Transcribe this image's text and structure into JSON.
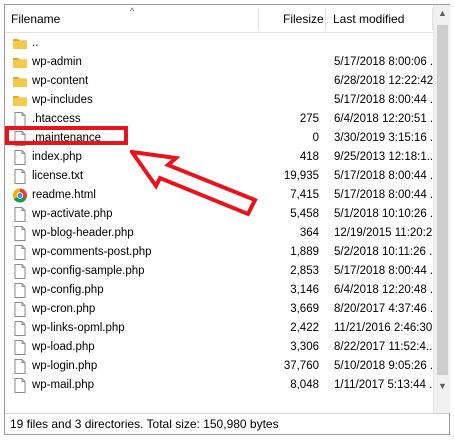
{
  "header": {
    "filename": "Filename",
    "filesize": "Filesize",
    "last_modified": "Last modified",
    "sort_indicator": "^"
  },
  "files": [
    {
      "name": "..",
      "size": "",
      "modified": "",
      "icon": "folder-icon"
    },
    {
      "name": "wp-admin",
      "size": "",
      "modified": "5/17/2018 8:00:06 ...",
      "icon": "folder-icon"
    },
    {
      "name": "wp-content",
      "size": "",
      "modified": "6/28/2018 12:22:42...",
      "icon": "folder-icon"
    },
    {
      "name": "wp-includes",
      "size": "",
      "modified": "5/17/2018 8:00:44 ...",
      "icon": "folder-icon"
    },
    {
      "name": ".htaccess",
      "size": "275",
      "modified": "6/4/2018 12:20:51 ...",
      "icon": "file-icon"
    },
    {
      "name": ".maintenance",
      "size": "0",
      "modified": "3/30/2019 3:15:16 ...",
      "icon": "file-icon"
    },
    {
      "name": "index.php",
      "size": "418",
      "modified": "9/25/2013 12:18:1...",
      "icon": "file-icon"
    },
    {
      "name": "license.txt",
      "size": "19,935",
      "modified": "5/17/2018 8:00:44 ...",
      "icon": "file-icon"
    },
    {
      "name": "readme.html",
      "size": "7,415",
      "modified": "5/17/2018 8:00:44 ...",
      "icon": "chrome-icon"
    },
    {
      "name": "wp-activate.php",
      "size": "5,458",
      "modified": "5/1/2018 10:10:26 ...",
      "icon": "file-icon"
    },
    {
      "name": "wp-blog-header.php",
      "size": "364",
      "modified": "12/19/2015 11:20:2...",
      "icon": "file-icon"
    },
    {
      "name": "wp-comments-post.php",
      "size": "1,889",
      "modified": "5/2/2018 10:11:26 ...",
      "icon": "file-icon"
    },
    {
      "name": "wp-config-sample.php",
      "size": "2,853",
      "modified": "5/17/2018 8:00:44 ...",
      "icon": "file-icon"
    },
    {
      "name": "wp-config.php",
      "size": "3,146",
      "modified": "6/4/2018 12:20:48 ...",
      "icon": "file-icon"
    },
    {
      "name": "wp-cron.php",
      "size": "3,669",
      "modified": "8/20/2017 4:37:46 ...",
      "icon": "file-icon"
    },
    {
      "name": "wp-links-opml.php",
      "size": "2,422",
      "modified": "11/21/2016 2:46:30...",
      "icon": "file-icon"
    },
    {
      "name": "wp-load.php",
      "size": "3,306",
      "modified": "8/22/2017 11:52:4...",
      "icon": "file-icon"
    },
    {
      "name": "wp-login.php",
      "size": "37,760",
      "modified": "5/10/2018 9:05:26 ...",
      "icon": "file-icon"
    },
    {
      "name": "wp-mail.php",
      "size": "8,048",
      "modified": "1/11/2017 5:13:44 ...",
      "icon": "file-icon"
    }
  ],
  "status": "19 files and 3 directories. Total size: 150,980 bytes",
  "colors": {
    "highlight": "#e8131b",
    "folder": "#f5c94a",
    "folder_dark": "#dcab2a"
  }
}
